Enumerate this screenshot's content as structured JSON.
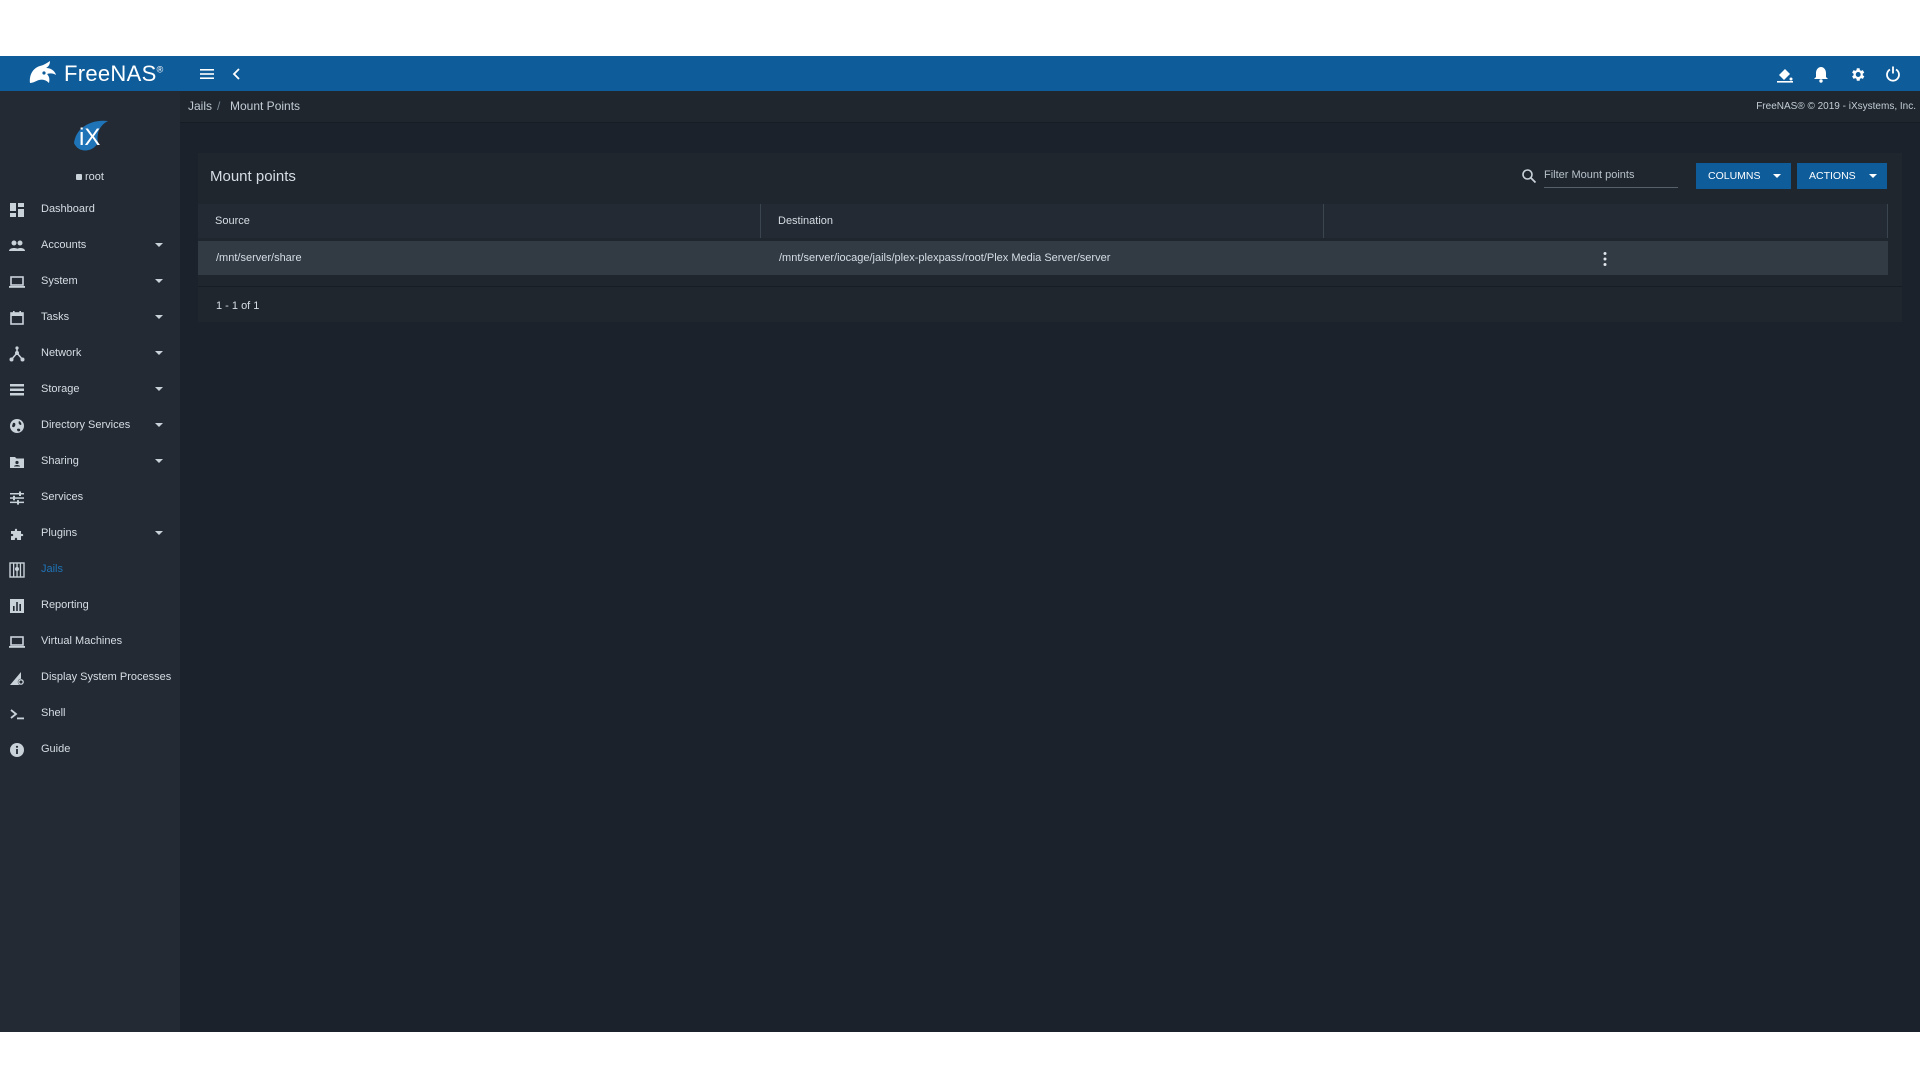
{
  "app": {
    "name": "FreeNAS",
    "trademark": "®",
    "copyright": "FreeNAS® © 2019 - iXsystems, Inc."
  },
  "user": {
    "name": "root",
    "logo_text": "iX"
  },
  "nav": [
    {
      "label": "Dashboard",
      "icon": "dashboard-icon",
      "expandable": false
    },
    {
      "label": "Accounts",
      "icon": "people-icon",
      "expandable": true
    },
    {
      "label": "System",
      "icon": "laptop-icon",
      "expandable": true
    },
    {
      "label": "Tasks",
      "icon": "calendar-icon",
      "expandable": true
    },
    {
      "label": "Network",
      "icon": "network-icon",
      "expandable": true
    },
    {
      "label": "Storage",
      "icon": "storage-list-icon",
      "expandable": true
    },
    {
      "label": "Directory Services",
      "icon": "globe-icon",
      "expandable": true
    },
    {
      "label": "Sharing",
      "icon": "folder-share-icon",
      "expandable": true
    },
    {
      "label": "Services",
      "icon": "sliders-icon",
      "expandable": false
    },
    {
      "label": "Plugins",
      "icon": "puzzle-icon",
      "expandable": true
    },
    {
      "label": "Jails",
      "icon": "jail-icon",
      "expandable": false,
      "active": true
    },
    {
      "label": "Reporting",
      "icon": "bar-chart-icon",
      "expandable": false
    },
    {
      "label": "Virtual Machines",
      "icon": "monitor-icon",
      "expandable": false
    },
    {
      "label": "Display System Processes",
      "icon": "processes-icon",
      "expandable": false
    },
    {
      "label": "Shell",
      "icon": "terminal-icon",
      "expandable": false
    },
    {
      "label": "Guide",
      "icon": "info-icon",
      "expandable": false
    }
  ],
  "breadcrumb": [
    "Jails",
    "Mount Points"
  ],
  "card": {
    "title": "Mount points",
    "filter_placeholder": "Filter Mount points",
    "columns_button": "COLUMNS",
    "actions_button": "ACTIONS"
  },
  "table": {
    "headers": [
      "Source",
      "Destination"
    ],
    "rows": [
      {
        "source": "/mnt/server/share",
        "destination": "/mnt/server/iocage/jails/plex-plexpass/root/Plex Media Server/server"
      }
    ],
    "paginator": "1 - 1 of 1"
  },
  "colors": {
    "topbar": "#0f5c9a",
    "sidebar": "#232a33",
    "background": "#1b222b",
    "active": "#1f73b7"
  }
}
